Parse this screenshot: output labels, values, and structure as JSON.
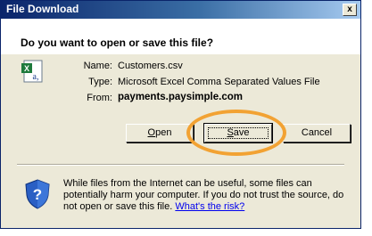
{
  "window": {
    "title": "File Download",
    "close_glyph": "x"
  },
  "question": "Do you want to open or save this file?",
  "file": {
    "icon": "excel-csv-file-icon",
    "name_label": "Name:",
    "name_value": "Customers.csv",
    "type_label": "Type:",
    "type_value": "Microsoft Excel Comma Separated Values File",
    "from_label": "From:",
    "from_value": "payments.paysimple.com"
  },
  "buttons": {
    "open_first": "O",
    "open_rest": "pen",
    "save_first": "S",
    "save_rest": "ave",
    "cancel": "Cancel"
  },
  "warning": {
    "icon": "shield-question-icon",
    "text": "While files from the Internet can be useful, some files can potentially harm your computer. If you do not trust the source, do not open or save this file. ",
    "link": "What's the risk?"
  },
  "colors": {
    "title_bar": "#0a246a",
    "dialog_bg": "#ece9d8",
    "highlight": "#f2a233",
    "link": "#0000ee"
  }
}
